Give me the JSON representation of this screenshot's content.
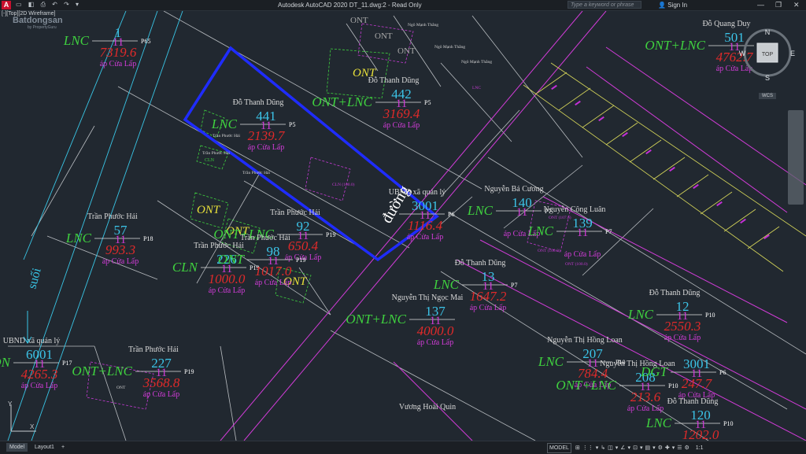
{
  "window": {
    "title": "Autodesk AutoCAD 2020    DT_11.dwg:2 - Read Only",
    "search_placeholder": "Type a keyword or phrase",
    "sign_in": "Sign In",
    "viewport_label": "[-][Top][2D Wireframe]",
    "qat_icons": "▭ ◧ ⎙ ↶ ↷ ▾"
  },
  "watermark": {
    "text": "Batdongsan",
    "sub": "by PropertyGuru"
  },
  "nav_cube": {
    "top": "TOP",
    "n": "N",
    "s": "S",
    "e": "E",
    "w": "W",
    "wcs": "WCS"
  },
  "parcels": [
    {
      "id": "p1",
      "type": "LNC",
      "number": "1",
      "sheet": "11",
      "area": "7319.6",
      "place": "áp Cửa Lấp",
      "map": "P65"
    },
    {
      "id": "p2",
      "owner": "Đỗ Thanh Dũng",
      "type": "LNC",
      "number": "441",
      "sheet": "11",
      "area": "2139.7",
      "place": "áp Cửa Lấp",
      "map": "P5"
    },
    {
      "id": "p3",
      "owner": "Đỗ Thanh Dũng",
      "type": "ONT+LNC",
      "number": "442",
      "sheet": "11",
      "area": "3169.4",
      "place": "áp Cửa Lấp",
      "map": "P5"
    },
    {
      "id": "p4",
      "owner": "Đỗ Quang Duy",
      "type": "ONT+LNC",
      "number": "501",
      "sheet": "11",
      "area": "4762.7",
      "place": "áp Cửa Lấp"
    },
    {
      "id": "p5",
      "owner": "Trần Phước Hải",
      "type": "LNC",
      "number": "57",
      "sheet": "11",
      "area": "993.3",
      "place": "áp Cửa Lấp",
      "map": "P18"
    },
    {
      "id": "p6",
      "owner": "Trần Phước Hải",
      "type": "ONT+LNC",
      "number": "92",
      "sheet": "11",
      "area": "650.4",
      "place": "áp Cửa Lấp",
      "map": "P19"
    },
    {
      "id": "p7",
      "owner": "Trần Phước Hải",
      "type": "CLN",
      "number": "226",
      "sheet": "11",
      "area": "1000.0",
      "place": "áp Cửa Lấp",
      "map": "P19"
    },
    {
      "id": "p8",
      "owner": "Trần Phước Hải",
      "type": "ONT",
      "number": "98",
      "sheet": "11",
      "area": "1017.0",
      "place": "áp Cửa Lấp",
      "map": "P19"
    },
    {
      "id": "p9",
      "owner": "UBND xã quản lý",
      "type": "",
      "number": "3001",
      "sheet": "11",
      "area": "1116.4",
      "place": "áp Cửa Lấp",
      "map": "P6"
    },
    {
      "id": "p10",
      "owner": "Nguyễn Bá Cương",
      "type": "LNC",
      "number": "140",
      "sheet": "11",
      "area": "",
      "place": "áp Cửa Lấp",
      "map": "P7"
    },
    {
      "id": "p11",
      "owner": "Nguyễn Công Luân",
      "type": "LNC",
      "number": "139",
      "sheet": "11",
      "area": "",
      "place": "áp Cửa Lấp",
      "map": "P7"
    },
    {
      "id": "p12",
      "owner": "Đỗ Thanh Dũng",
      "type": "LNC",
      "number": "13",
      "sheet": "11",
      "area": "1647.2",
      "place": "áp Cửa Lấp",
      "map": "P7"
    },
    {
      "id": "p13",
      "owner": "Nguyễn Thị Ngọc Mai",
      "type": "ONT+LNC",
      "number": "137",
      "sheet": "11",
      "area": "4000.0",
      "place": "áp Cửa Lấp"
    },
    {
      "id": "p14",
      "owner": "Đỗ Thanh Dũng",
      "type": "LNC",
      "number": "12",
      "sheet": "11",
      "area": "2550.3",
      "place": "áp Cửa Lấp",
      "map": "P10"
    },
    {
      "id": "p15",
      "owner": "UBND xã quản lý",
      "type": "ON",
      "number": "6001",
      "sheet": "11",
      "area": "4265.3",
      "place": "áp Cửa Lấp",
      "map": "P17"
    },
    {
      "id": "p16",
      "owner": "Trần Phước Hải",
      "type": "ONT+LNC",
      "number": "227",
      "sheet": "11",
      "area": "3568.8",
      "place": "áp Cửa Lấp",
      "map": "P19"
    },
    {
      "id": "p17",
      "owner": "Nguyễn Thị Hồng Loan",
      "type": "LNC",
      "number": "207",
      "sheet": "11",
      "area": "784.4",
      "place": "áp Cửa Lấp",
      "map": "P10"
    },
    {
      "id": "p18",
      "owner": "Nguyễn Thị Hồng Loan",
      "type": "ONT+LNC",
      "number": "208",
      "sheet": "11",
      "area": "213.6",
      "place": "áp Cửa Lấp",
      "map": "P10"
    },
    {
      "id": "p19",
      "owner": "",
      "type": "DGT",
      "number": "3001",
      "sheet": "11",
      "area": "247.7",
      "place": "áp Cửa Lấp",
      "map": "P6"
    },
    {
      "id": "p20",
      "owner": "Đỗ Thanh Dũng",
      "type": "LNC",
      "number": "120",
      "sheet": "11",
      "area": "1202.0",
      "place": "",
      "map": "P10"
    },
    {
      "id": "p21",
      "owner": "Vương Hoài Quìn",
      "type": "",
      "number": "",
      "sheet": "",
      "area": "",
      "place": ""
    }
  ],
  "land_tags": {
    "ont1": "ONT",
    "ont2": "ONT",
    "ont3": "ONT",
    "ont4": "ONT",
    "ont5": "ONT",
    "ont6": "ONT",
    "ont7": "ONT",
    "cln": "CLN"
  },
  "small_labels": {
    "owner_thang1": "Ngô Mạnh Thắng",
    "owner_thang2": "Ngô Mạnh Thắng",
    "owner_thang3": "Ngô Mạnh Thắng",
    "lnc_small": "LNC",
    "tran_hai_small1": "Trần Phước Hải",
    "tran_hai_small2": "Trần Phước Hải",
    "tran_hai_small3": "Trần Phước Hải",
    "cln_small": "CLN",
    "ont_inner_1": "ONT (107.6)",
    "ont_inner_2": "ONT (100.0)",
    "ont_inner_3": "ONT (100.0)",
    "ont_inner_4": "ONT",
    "cln_inner": "CLN (100.0)"
  },
  "features": {
    "stream": "suối",
    "road": "đường"
  },
  "status": {
    "tab_model": "Model",
    "tab_layout": "Layout1",
    "add_tab": "+",
    "mode": "MODEL",
    "scale": "1:1",
    "tool_icons": [
      "⊞",
      "⋮⋮",
      "▾",
      "↳",
      "◫",
      "▾",
      "∠",
      "▾",
      "⊡",
      "▾",
      "▤",
      "▾",
      "⚙",
      "✚",
      "▾",
      "☰",
      "⚙"
    ]
  }
}
